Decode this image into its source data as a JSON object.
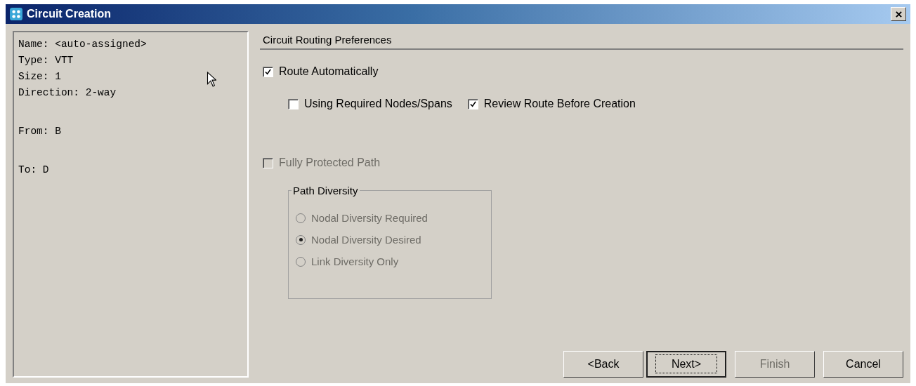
{
  "window": {
    "title": "Circuit Creation"
  },
  "summary_groups": [
    [
      "Name: <auto-assigned>",
      "Type: VTT",
      "Size: 1",
      "Direction: 2-way"
    ],
    [
      "From: B"
    ],
    [
      "To: D"
    ]
  ],
  "preferences": {
    "heading": "Circuit Routing Preferences",
    "route_automatically": {
      "label": "Route Automatically",
      "checked": true,
      "disabled": false
    },
    "sub_options": [
      {
        "label": "Using Required Nodes/Spans",
        "checked": false,
        "disabled": false
      },
      {
        "label": "Review Route Before Creation",
        "checked": true,
        "disabled": false
      }
    ],
    "fully_protected": {
      "label": "Fully Protected Path",
      "checked": false,
      "disabled": true
    },
    "path_diversity": {
      "title": "Path Diversity",
      "disabled": true,
      "options": [
        {
          "label": "Nodal Diversity Required",
          "selected": false
        },
        {
          "label": "Nodal Diversity Desired",
          "selected": true
        },
        {
          "label": "Link Diversity Only",
          "selected": false
        }
      ]
    }
  },
  "buttons": [
    {
      "label": "<Back",
      "disabled": false,
      "focused": false
    },
    {
      "label": "Next>",
      "disabled": false,
      "focused": true
    },
    {
      "label": "Finish",
      "disabled": true,
      "focused": false
    },
    {
      "label": "Cancel",
      "disabled": false,
      "focused": false
    }
  ]
}
